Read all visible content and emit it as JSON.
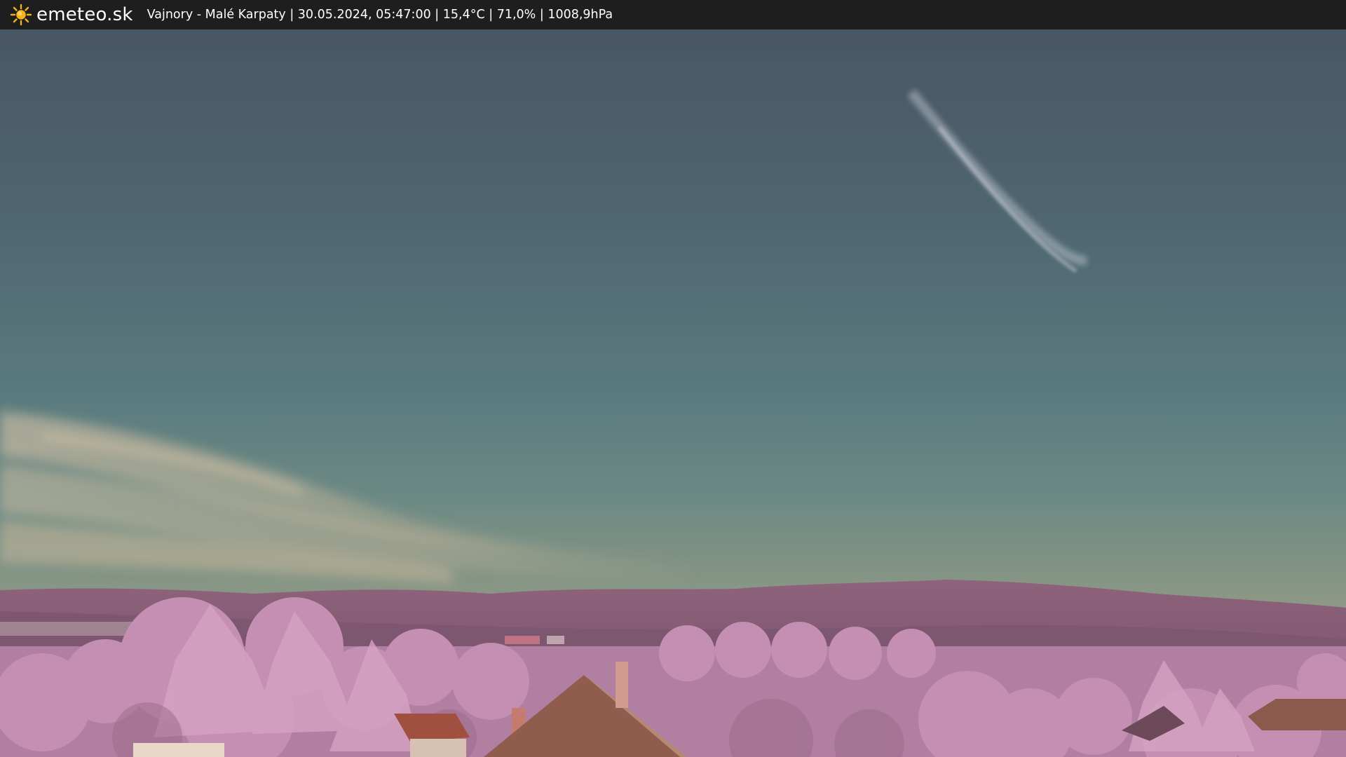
{
  "header": {
    "brand": "emeteo.sk",
    "logo_icon": "sun-icon",
    "caption": "Vajnory - Malé Karpaty | 30.05.2024, 05:47:00 | 15,4°C | 71,0% | 1008,9hPa"
  },
  "scene": {
    "description_colors": {
      "sky_top": "#4a5866",
      "sky_mid": "#5d7d80",
      "sky_horizon": "#a59e86",
      "hills": "#8a5f79",
      "foliage": "#c692b4",
      "roof": "#8b5a4c"
    }
  }
}
